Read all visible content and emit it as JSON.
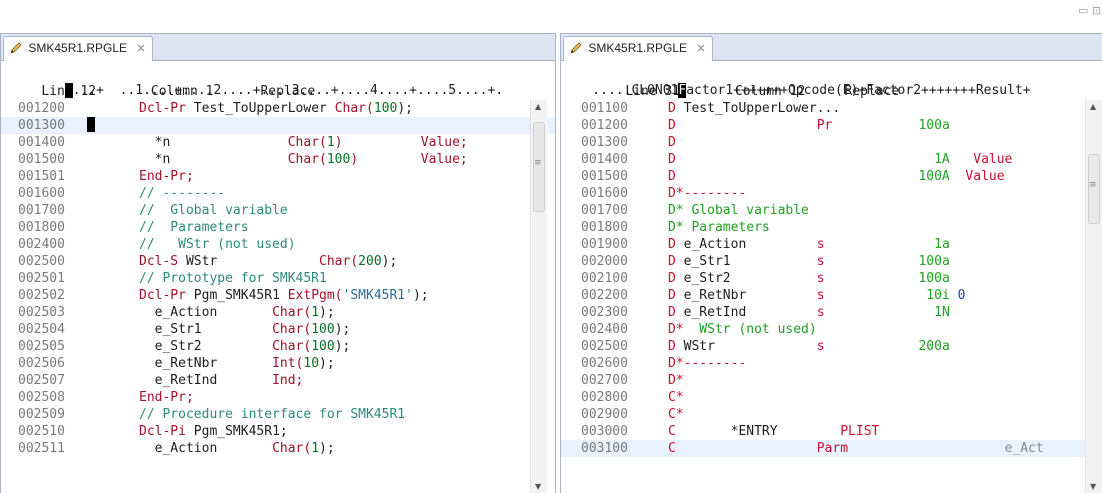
{
  "window_controls": "▭ ⊡",
  "colors": {
    "tab_bar": "#dce5f0",
    "border": "#a9b5c6",
    "highlight": "#e8f2fe",
    "keyword": "#a0112a",
    "literal": "#0a6e28",
    "comment": "#2c8a7d",
    "spec": "#c8102e"
  },
  "icons": {
    "tab": "pencil-file-icon",
    "close": "close-icon"
  },
  "left_editor": {
    "tab_label": "SMK45R1.RPGLE",
    "status": "Line 12       Column 1      Replace",
    "ruler": {
      "before": "       ",
      "cursor": " ",
      "after": "...+  ..1....+....2....+....3....+....4....+....5....+."
    },
    "lines": [
      {
        "seq": "001200",
        "tokens": [
          {
            "t": "Dcl-Pr ",
            "c": "kw"
          },
          {
            "t": "Test_ToUpperLower ",
            "c": ""
          },
          {
            "t": "Char(",
            "c": "kw"
          },
          {
            "t": "100",
            "c": "num"
          },
          {
            "t": ");",
            "c": ""
          }
        ]
      },
      {
        "seq": "001300",
        "tokens": [],
        "cursor": true,
        "highlight": true
      },
      {
        "seq": "001400",
        "tokens": [
          {
            "t": "  *n               ",
            "c": ""
          },
          {
            "t": "Char(",
            "c": "kw"
          },
          {
            "t": "1",
            "c": "num"
          },
          {
            "t": ")          ",
            "c": "kw"
          },
          {
            "t": "Value;",
            "c": "kw"
          }
        ]
      },
      {
        "seq": "001500",
        "tokens": [
          {
            "t": "  *n               ",
            "c": ""
          },
          {
            "t": "Char(",
            "c": "kw"
          },
          {
            "t": "100",
            "c": "num"
          },
          {
            "t": ")        ",
            "c": "kw"
          },
          {
            "t": "Value;",
            "c": "kw"
          }
        ]
      },
      {
        "seq": "001501",
        "tokens": [
          {
            "t": "End-Pr;",
            "c": "kw"
          }
        ]
      },
      {
        "seq": "001600",
        "tokens": [
          {
            "t": "// --------",
            "c": "cmt"
          }
        ]
      },
      {
        "seq": "001700",
        "tokens": [
          {
            "t": "//  Global variable",
            "c": "cmt"
          }
        ]
      },
      {
        "seq": "001800",
        "tokens": [
          {
            "t": "//  Parameters",
            "c": "cmt"
          }
        ]
      },
      {
        "seq": "002400",
        "tokens": [
          {
            "t": "//   WStr (not used)",
            "c": "cmt"
          }
        ]
      },
      {
        "seq": "002500",
        "tokens": [
          {
            "t": "Dcl-S ",
            "c": "kw"
          },
          {
            "t": "WStr             ",
            "c": ""
          },
          {
            "t": "Char(",
            "c": "kw"
          },
          {
            "t": "200",
            "c": "num"
          },
          {
            "t": ");",
            "c": ""
          }
        ]
      },
      {
        "seq": "002501",
        "tokens": [
          {
            "t": "// Prototype for SMK45R1",
            "c": "cmt"
          }
        ]
      },
      {
        "seq": "002502",
        "tokens": [
          {
            "t": "Dcl-Pr ",
            "c": "kw"
          },
          {
            "t": "Pgm_SMK45R1 ",
            "c": ""
          },
          {
            "t": "ExtPgm(",
            "c": "kw"
          },
          {
            "t": "'SMK45R1'",
            "c": "str"
          },
          {
            "t": ");",
            "c": ""
          }
        ]
      },
      {
        "seq": "002503",
        "tokens": [
          {
            "t": "  e_Action       ",
            "c": ""
          },
          {
            "t": "Char(",
            "c": "kw"
          },
          {
            "t": "1",
            "c": "num"
          },
          {
            "t": ");",
            "c": ""
          }
        ]
      },
      {
        "seq": "002504",
        "tokens": [
          {
            "t": "  e_Str1         ",
            "c": ""
          },
          {
            "t": "Char(",
            "c": "kw"
          },
          {
            "t": "100",
            "c": "num"
          },
          {
            "t": ");",
            "c": ""
          }
        ]
      },
      {
        "seq": "002505",
        "tokens": [
          {
            "t": "  e_Str2         ",
            "c": ""
          },
          {
            "t": "Char(",
            "c": "kw"
          },
          {
            "t": "100",
            "c": "num"
          },
          {
            "t": ");",
            "c": ""
          }
        ]
      },
      {
        "seq": "002506",
        "tokens": [
          {
            "t": "  e_RetNbr       ",
            "c": ""
          },
          {
            "t": "Int(",
            "c": "kw"
          },
          {
            "t": "10",
            "c": "num"
          },
          {
            "t": ");",
            "c": ""
          }
        ]
      },
      {
        "seq": "002507",
        "tokens": [
          {
            "t": "  e_RetInd       ",
            "c": ""
          },
          {
            "t": "Ind;",
            "c": "kw"
          }
        ]
      },
      {
        "seq": "002508",
        "tokens": [
          {
            "t": "End-Pr;",
            "c": "kw"
          }
        ]
      },
      {
        "seq": "002509",
        "tokens": [
          {
            "t": "// Procedure interface for SMK45R1",
            "c": "cmt"
          }
        ]
      },
      {
        "seq": "002510",
        "tokens": [
          {
            "t": "Dcl-Pi ",
            "c": "kw"
          },
          {
            "t": "Pgm_SMK45R1;",
            "c": ""
          }
        ]
      },
      {
        "seq": "002511",
        "tokens": [
          {
            "t": "  e_Action       ",
            "c": ""
          },
          {
            "t": "Char(",
            "c": "kw"
          },
          {
            "t": "1",
            "c": "num"
          },
          {
            "t": ");",
            "c": ""
          }
        ]
      }
    ]
  },
  "right_editor": {
    "tab_label": "SMK45R1.RPGLE",
    "status": "Line 31       Column 12     Replace",
    "ruler": {
      "before": "    .....CL0N01",
      "cursor": "F",
      "after": "actor1+++++++Opcode(E)+Factor2+++++++Result+"
    },
    "lines": [
      {
        "seq": "001100",
        "tokens": [
          {
            "t": "D ",
            "c": "red"
          },
          {
            "t": "Test_ToUpperLower...",
            "c": ""
          }
        ]
      },
      {
        "seq": "001200",
        "tokens": [
          {
            "t": "D                  ",
            "c": "red"
          },
          {
            "t": "Pr",
            "c": "red"
          },
          {
            "t": "           ",
            "c": ""
          },
          {
            "t": "100a",
            "c": "grn"
          }
        ]
      },
      {
        "seq": "001300",
        "tokens": [
          {
            "t": "D",
            "c": "red"
          }
        ]
      },
      {
        "seq": "001400",
        "tokens": [
          {
            "t": "D                                 ",
            "c": "red"
          },
          {
            "t": "1A",
            "c": "grn"
          },
          {
            "t": "   ",
            "c": ""
          },
          {
            "t": "Value",
            "c": "red"
          }
        ]
      },
      {
        "seq": "001500",
        "tokens": [
          {
            "t": "D                               ",
            "c": "red"
          },
          {
            "t": "100A",
            "c": "grn"
          },
          {
            "t": "  ",
            "c": ""
          },
          {
            "t": "Value",
            "c": "red"
          }
        ]
      },
      {
        "seq": "001600",
        "tokens": [
          {
            "t": "D*--------",
            "c": "red"
          }
        ]
      },
      {
        "seq": "001700",
        "tokens": [
          {
            "t": "D* Global variable",
            "c": "grn"
          }
        ]
      },
      {
        "seq": "001800",
        "tokens": [
          {
            "t": "D* Parameters",
            "c": "grn"
          }
        ]
      },
      {
        "seq": "001900",
        "tokens": [
          {
            "t": "D ",
            "c": "red"
          },
          {
            "t": "e_Action         ",
            "c": ""
          },
          {
            "t": "s",
            "c": "red"
          },
          {
            "t": "              ",
            "c": ""
          },
          {
            "t": "1a",
            "c": "grn"
          }
        ]
      },
      {
        "seq": "002000",
        "tokens": [
          {
            "t": "D ",
            "c": "red"
          },
          {
            "t": "e_Str1           ",
            "c": ""
          },
          {
            "t": "s",
            "c": "red"
          },
          {
            "t": "            ",
            "c": ""
          },
          {
            "t": "100a",
            "c": "grn"
          }
        ]
      },
      {
        "seq": "002100",
        "tokens": [
          {
            "t": "D ",
            "c": "red"
          },
          {
            "t": "e_Str2           ",
            "c": ""
          },
          {
            "t": "s",
            "c": "red"
          },
          {
            "t": "            ",
            "c": ""
          },
          {
            "t": "100a",
            "c": "grn"
          }
        ]
      },
      {
        "seq": "002200",
        "tokens": [
          {
            "t": "D ",
            "c": "red"
          },
          {
            "t": "e_RetNbr         ",
            "c": ""
          },
          {
            "t": "s",
            "c": "red"
          },
          {
            "t": "             ",
            "c": ""
          },
          {
            "t": "10i ",
            "c": "grn"
          },
          {
            "t": "0",
            "c": "blue"
          }
        ]
      },
      {
        "seq": "002300",
        "tokens": [
          {
            "t": "D ",
            "c": "red"
          },
          {
            "t": "e_RetInd         ",
            "c": ""
          },
          {
            "t": "s",
            "c": "red"
          },
          {
            "t": "              ",
            "c": ""
          },
          {
            "t": "1N",
            "c": "grn"
          }
        ]
      },
      {
        "seq": "002400",
        "tokens": [
          {
            "t": "D*",
            "c": "red"
          },
          {
            "t": "  WStr (not used)",
            "c": "grn"
          }
        ]
      },
      {
        "seq": "002500",
        "tokens": [
          {
            "t": "D ",
            "c": "red"
          },
          {
            "t": "WStr             ",
            "c": ""
          },
          {
            "t": "s",
            "c": "red"
          },
          {
            "t": "            ",
            "c": ""
          },
          {
            "t": "200a",
            "c": "grn"
          }
        ]
      },
      {
        "seq": "002600",
        "tokens": [
          {
            "t": "D*--------",
            "c": "red"
          }
        ]
      },
      {
        "seq": "002700",
        "tokens": [
          {
            "t": "D*",
            "c": "red"
          }
        ]
      },
      {
        "seq": "002800",
        "tokens": [
          {
            "t": "C*",
            "c": "red"
          }
        ]
      },
      {
        "seq": "002900",
        "tokens": [
          {
            "t": "C*",
            "c": "red"
          }
        ]
      },
      {
        "seq": "003000",
        "tokens": [
          {
            "t": "C       ",
            "c": "red"
          },
          {
            "t": "*ENTRY",
            "c": ""
          },
          {
            "t": "        ",
            "c": ""
          },
          {
            "t": "PLIST",
            "c": "red"
          }
        ]
      },
      {
        "seq": "003100",
        "tokens": [
          {
            "t": "C                  ",
            "c": "red"
          },
          {
            "t": "Parm",
            "c": "red"
          },
          {
            "t": "                    ",
            "c": ""
          },
          {
            "t": "e_Act",
            "c": "dim"
          }
        ],
        "highlight": true
      }
    ]
  }
}
